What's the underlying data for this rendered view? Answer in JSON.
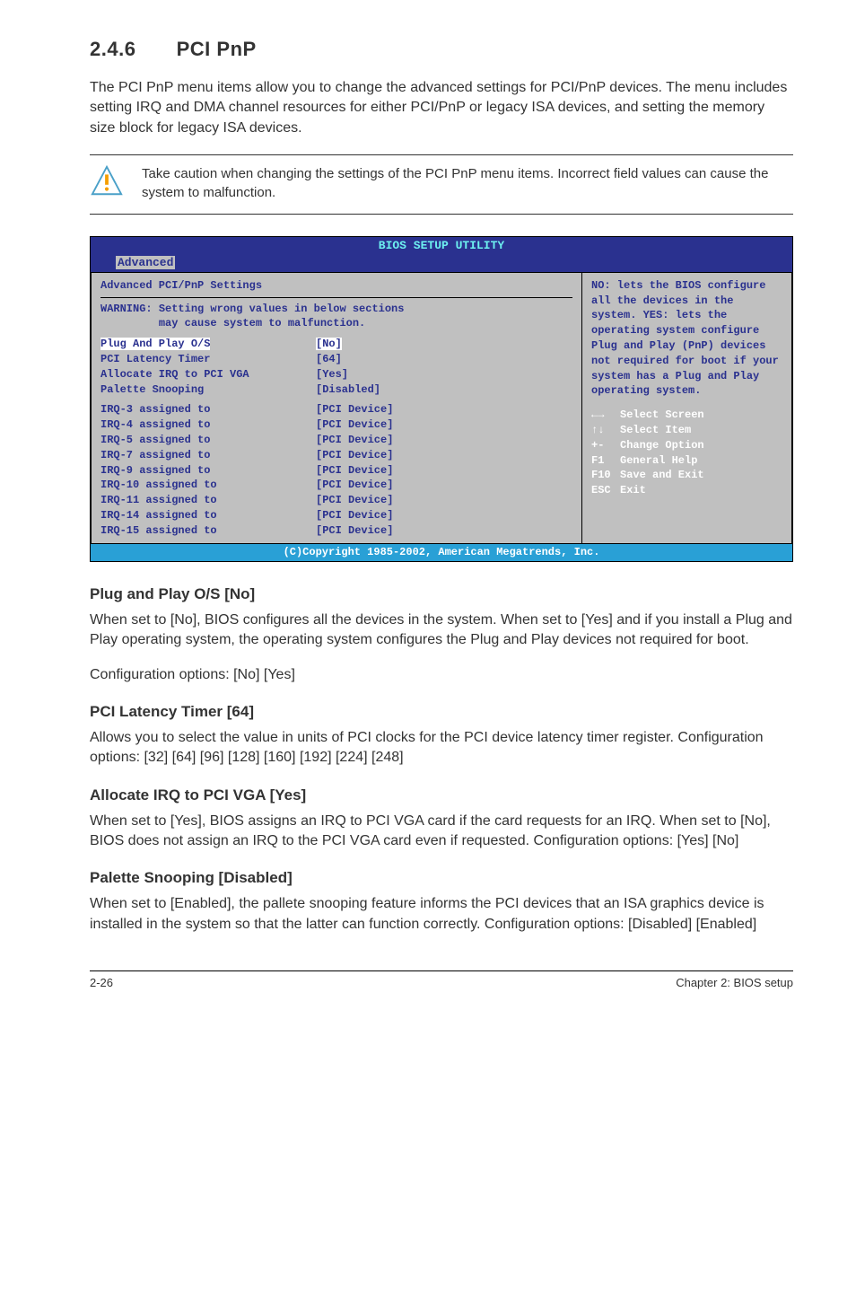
{
  "section": {
    "number": "2.4.6",
    "title": "PCI PnP"
  },
  "intro": "The PCI PnP menu items allow you to change the advanced settings for PCI/PnP devices. The menu includes setting IRQ and DMA channel resources for either PCI/PnP or legacy ISA devices, and setting the memory size block for legacy ISA devices.",
  "callout": "Take caution when changing the settings of the PCI PnP menu items. Incorrect field values can cause the system to malfunction.",
  "bios": {
    "title": "BIOS SETUP UTILITY",
    "tab": "Advanced",
    "heading": "Advanced PCI/PnP Settings",
    "warning_label": "WARNING:",
    "warning_line1": "Setting wrong values in below sections",
    "warning_line2": "may cause system to malfunction.",
    "settings": [
      {
        "label": "Plug And Play O/S",
        "value": "[No]",
        "selected": true
      },
      {
        "label": "PCI Latency Timer",
        "value": "[64]"
      },
      {
        "label": "Allocate IRQ to PCI VGA",
        "value": "[Yes]"
      },
      {
        "label": "Palette Snooping",
        "value": "[Disabled]"
      }
    ],
    "irq": [
      {
        "label": "IRQ-3 assigned to",
        "value": "[PCI Device]"
      },
      {
        "label": "IRQ-4 assigned to",
        "value": "[PCI Device]"
      },
      {
        "label": "IRQ-5 assigned to",
        "value": "[PCI Device]"
      },
      {
        "label": "IRQ-7 assigned to",
        "value": "[PCI Device]"
      },
      {
        "label": "IRQ-9 assigned to",
        "value": "[PCI Device]"
      },
      {
        "label": "IRQ-10 assigned to",
        "value": "[PCI Device]"
      },
      {
        "label": "IRQ-11 assigned to",
        "value": "[PCI Device]"
      },
      {
        "label": "IRQ-14 assigned to",
        "value": "[PCI Device]"
      },
      {
        "label": "IRQ-15 assigned to",
        "value": "[PCI Device]"
      }
    ],
    "help": "NO: lets the BIOS configure  all the devices in the system. YES: lets the operating system configure Plug and Play (PnP) devices not required for boot if your system has a Plug and Play operating system.",
    "keys": [
      {
        "k": "←→",
        "d": "Select Screen"
      },
      {
        "k": "↑↓",
        "d": "Select Item"
      },
      {
        "k": "+-",
        "d": "Change Option"
      },
      {
        "k": "F1",
        "d": "General Help"
      },
      {
        "k": "F10",
        "d": "Save and Exit"
      },
      {
        "k": "ESC",
        "d": "Exit"
      }
    ],
    "footer": "(C)Copyright 1985-2002, American Megatrends, Inc."
  },
  "subsections": {
    "s1": {
      "title": "Plug and Play O/S [No]",
      "p1": "When set to [No], BIOS configures all the devices in the system. When set to [Yes] and if you install a Plug and Play operating system, the operating system configures the Plug and Play devices not required for boot.",
      "p2": "Configuration options: [No] [Yes]"
    },
    "s2": {
      "title": "PCI Latency Timer [64]",
      "p1": "Allows you to select the value in units of PCI clocks for the PCI device latency timer register. Configuration options: [32] [64] [96] [128] [160] [192] [224] [248]"
    },
    "s3": {
      "title": "Allocate IRQ to PCI VGA [Yes]",
      "p1": "When set to [Yes], BIOS assigns an IRQ to PCI VGA card if the card requests for an IRQ. When set to [No], BIOS does not assign an IRQ to the PCI VGA card even if requested. Configuration options: [Yes] [No]"
    },
    "s4": {
      "title": "Palette Snooping [Disabled]",
      "p1": "When set to [Enabled], the pallete snooping feature informs the PCI devices that an ISA graphics device is installed in the system so that the latter can function correctly. Configuration options: [Disabled] [Enabled]"
    }
  },
  "footer": {
    "left": "2-26",
    "right": "Chapter 2: BIOS setup"
  }
}
